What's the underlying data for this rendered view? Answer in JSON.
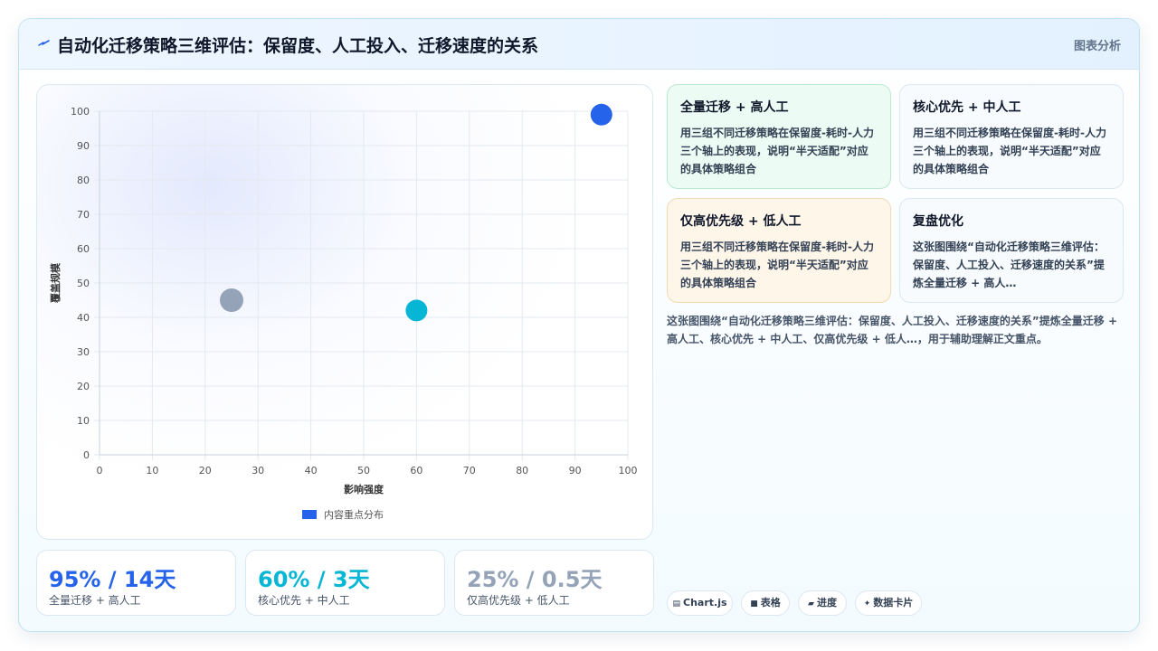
{
  "header": {
    "title": "自动化迁移策略三维评估：保留度、人工投入、迁移速度的关系",
    "tag": "图表分析"
  },
  "chart_data": {
    "type": "bubble",
    "xlabel": "影响强度",
    "ylabel": "覆盖规模",
    "xlim": [
      0,
      100
    ],
    "ylim": [
      0,
      100
    ],
    "x_ticks": [
      "0",
      "10",
      "20",
      "30",
      "40",
      "50",
      "60",
      "70",
      "80",
      "90",
      "100"
    ],
    "y_ticks": [
      "0",
      "10",
      "20",
      "30",
      "40",
      "50",
      "60",
      "70",
      "80",
      "90",
      "100"
    ],
    "grid": true,
    "legend": {
      "placement": "bottom",
      "label": "内容重点分布",
      "color": "#2563eb"
    },
    "points": [
      {
        "x": 95,
        "y": 99,
        "r": 12,
        "color": "#2563eb"
      },
      {
        "x": 60,
        "y": 42,
        "r": 12,
        "color": "#06b6d4"
      },
      {
        "x": 25,
        "y": 45,
        "r": 13,
        "color": "#94a3b8"
      }
    ]
  },
  "stats": [
    {
      "value": "95% / 14天",
      "label": "全量迁移 + 高人工",
      "color": "#2563eb"
    },
    {
      "value": "60% / 3天",
      "label": "核心优先 + 中人工",
      "color": "#06b6d4"
    },
    {
      "value": "25% / 0.5天",
      "label": "仅高优先级 + 低人工",
      "color": "#94a3b8"
    }
  ],
  "insights": [
    {
      "title": "全量迁移 + 高人工",
      "desc": "用三组不同迁移策略在保留度-耗时-人力三个轴上的表现，说明“半天适配”对应的具体策略组合",
      "bg": "#ecfbf3",
      "border": "#b9ead0"
    },
    {
      "title": "核心优先 + 中人工",
      "desc": "用三组不同迁移策略在保留度-耗时-人力三个轴上的表现，说明“半天适配”对应的具体策略组合",
      "bg": "#f7fbfe",
      "border": "#dbe7f1"
    },
    {
      "title": "仅高优先级 + 低人工",
      "desc": "用三组不同迁移策略在保留度-耗时-人力三个轴上的表现，说明“半天适配”对应的具体策略组合",
      "bg": "#fff6ea",
      "border": "#f3d9b4"
    },
    {
      "title": "复盘优化",
      "desc": "这张图围绕“自动化迁移策略三维评估：保留度、人工投入、迁移速度的关系”提炼全量迁移 + 高人…",
      "bg": "#f7fbfe",
      "border": "#dbe7f1"
    }
  ],
  "summary": "这张图围绕“自动化迁移策略三维评估：保留度、人工投入、迁移速度的关系”提炼全量迁移 + 高人工、核心优先 + 中人工、仅高优先级 + 低人…，用于辅助理解正文重点。",
  "chips": [
    {
      "icon": "▤",
      "label": "Chart.js"
    },
    {
      "icon": "■",
      "label": "表格"
    },
    {
      "icon": "▰",
      "label": "进度"
    },
    {
      "icon": "✦",
      "label": "数据卡片"
    }
  ],
  "colors": {
    "accent": "#2563eb",
    "cyan": "#06b6d4",
    "gray": "#94a3b8"
  }
}
